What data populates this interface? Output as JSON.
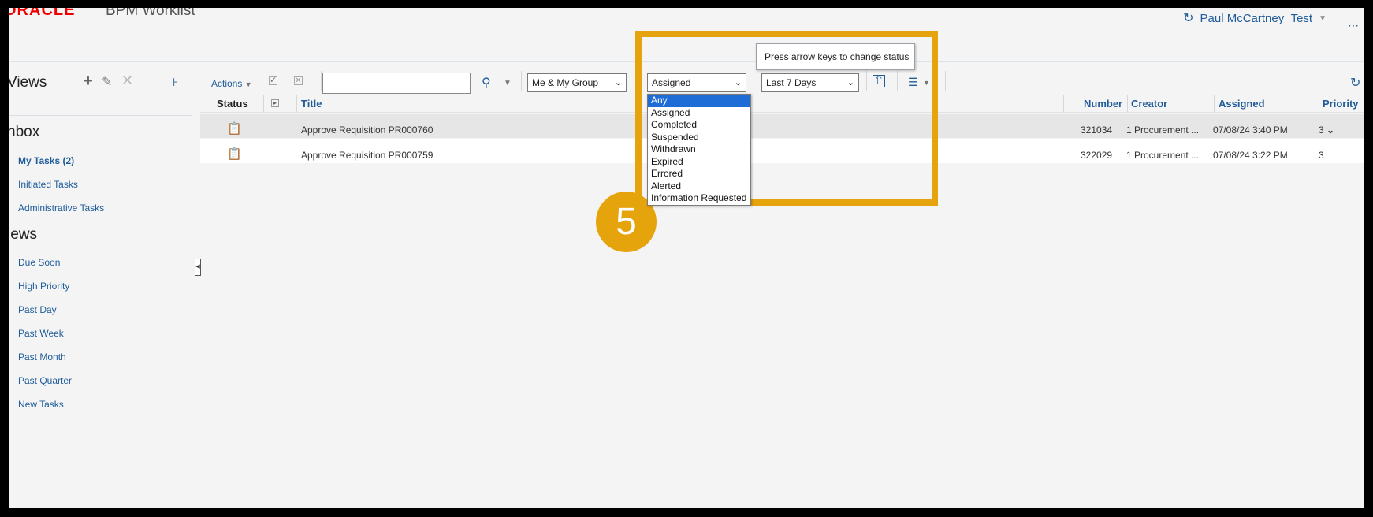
{
  "header": {
    "logo": "ORACLE",
    "app_title": "BPM Worklist",
    "user": "Paul McCartney_Test"
  },
  "left_panel": {
    "views_title": "Views",
    "inbox_title": "nbox",
    "inbox_items": [
      {
        "label": "My Tasks (2)"
      },
      {
        "label": "Initiated Tasks"
      },
      {
        "label": "Administrative Tasks"
      }
    ],
    "views2_title": "iews",
    "view_items": [
      {
        "label": "Due Soon"
      },
      {
        "label": "High Priority"
      },
      {
        "label": "Past Day"
      },
      {
        "label": "Past Week"
      },
      {
        "label": "Past Month"
      },
      {
        "label": "Past Quarter"
      },
      {
        "label": "New Tasks"
      }
    ]
  },
  "toolbar": {
    "actions_label": "Actions",
    "search_value": "",
    "assignee_filter": "Me & My Group",
    "status_filter": "Assigned",
    "date_filter": "Last 7 Days"
  },
  "status_options": [
    "Any",
    "Assigned",
    "Completed",
    "Suspended",
    "Withdrawn",
    "Expired",
    "Errored",
    "Alerted",
    "Information Requested"
  ],
  "tooltip": "Press arrow keys to change status",
  "step_number": "5",
  "table": {
    "columns": {
      "status": "Status",
      "title": "Title",
      "number": "Number",
      "creator": "Creator",
      "assigned": "Assigned",
      "priority": "Priority"
    },
    "rows": [
      {
        "title": "Approve Requisition PR000760",
        "number": "321034",
        "creator": "1 Procurement ...",
        "assigned": "07/08/24 3:40 PM",
        "priority": "3"
      },
      {
        "title": "Approve Requisition PR000759",
        "number": "322029",
        "creator": "1 Procurement ...",
        "assigned": "07/08/24 3:22 PM",
        "priority": "3"
      }
    ]
  },
  "colors": {
    "highlight": "#e6a40c",
    "link": "#1f5c99",
    "selected_option": "#1e6cd6"
  }
}
